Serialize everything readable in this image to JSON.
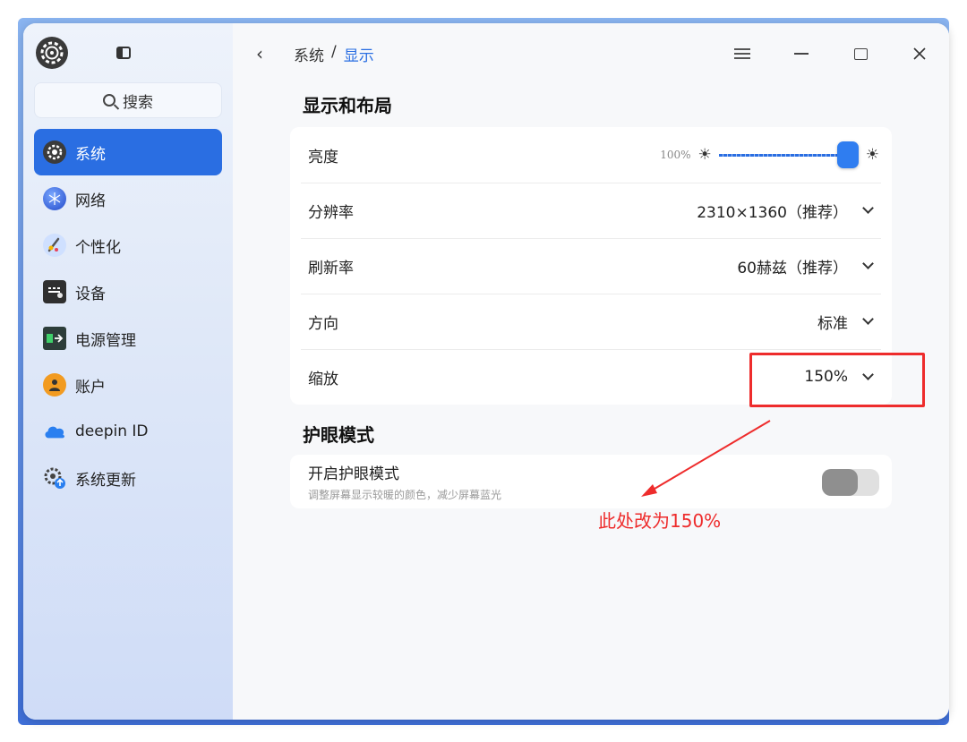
{
  "sidebar": {
    "search_label": "搜索",
    "items": [
      {
        "label": "系统",
        "icon": "system-icon",
        "active": true
      },
      {
        "label": "网络",
        "icon": "network-icon"
      },
      {
        "label": "个性化",
        "icon": "personalization-icon"
      },
      {
        "label": "设备",
        "icon": "device-icon"
      },
      {
        "label": "电源管理",
        "icon": "power-icon"
      },
      {
        "label": "账户",
        "icon": "account-icon"
      },
      {
        "label": "deepin ID",
        "icon": "cloud-icon"
      },
      {
        "label": "系统更新",
        "icon": "update-icon"
      }
    ]
  },
  "header": {
    "crumb_parent": "系统",
    "crumb_sep": "/",
    "crumb_current": "显示"
  },
  "display": {
    "section_title": "显示和布局",
    "brightness": {
      "label": "亮度",
      "percent_text": "100%",
      "value": 1.0
    },
    "resolution": {
      "label": "分辨率",
      "value": "2310×1360（推荐）"
    },
    "refresh": {
      "label": "刷新率",
      "value": "60赫兹（推荐）"
    },
    "orientation": {
      "label": "方向",
      "value": "标准"
    },
    "scale": {
      "label": "缩放",
      "value": "150%"
    }
  },
  "eye": {
    "section_title": "护眼模式",
    "toggle_label": "开启护眼模式",
    "toggle_desc": "调整屏幕显示较暖的颜色，减少屏幕蓝光",
    "enabled": false
  },
  "annotation": {
    "text": "此处改为150%",
    "color": "#ee2c2c"
  },
  "colors": {
    "accent": "#2a6ee2"
  }
}
